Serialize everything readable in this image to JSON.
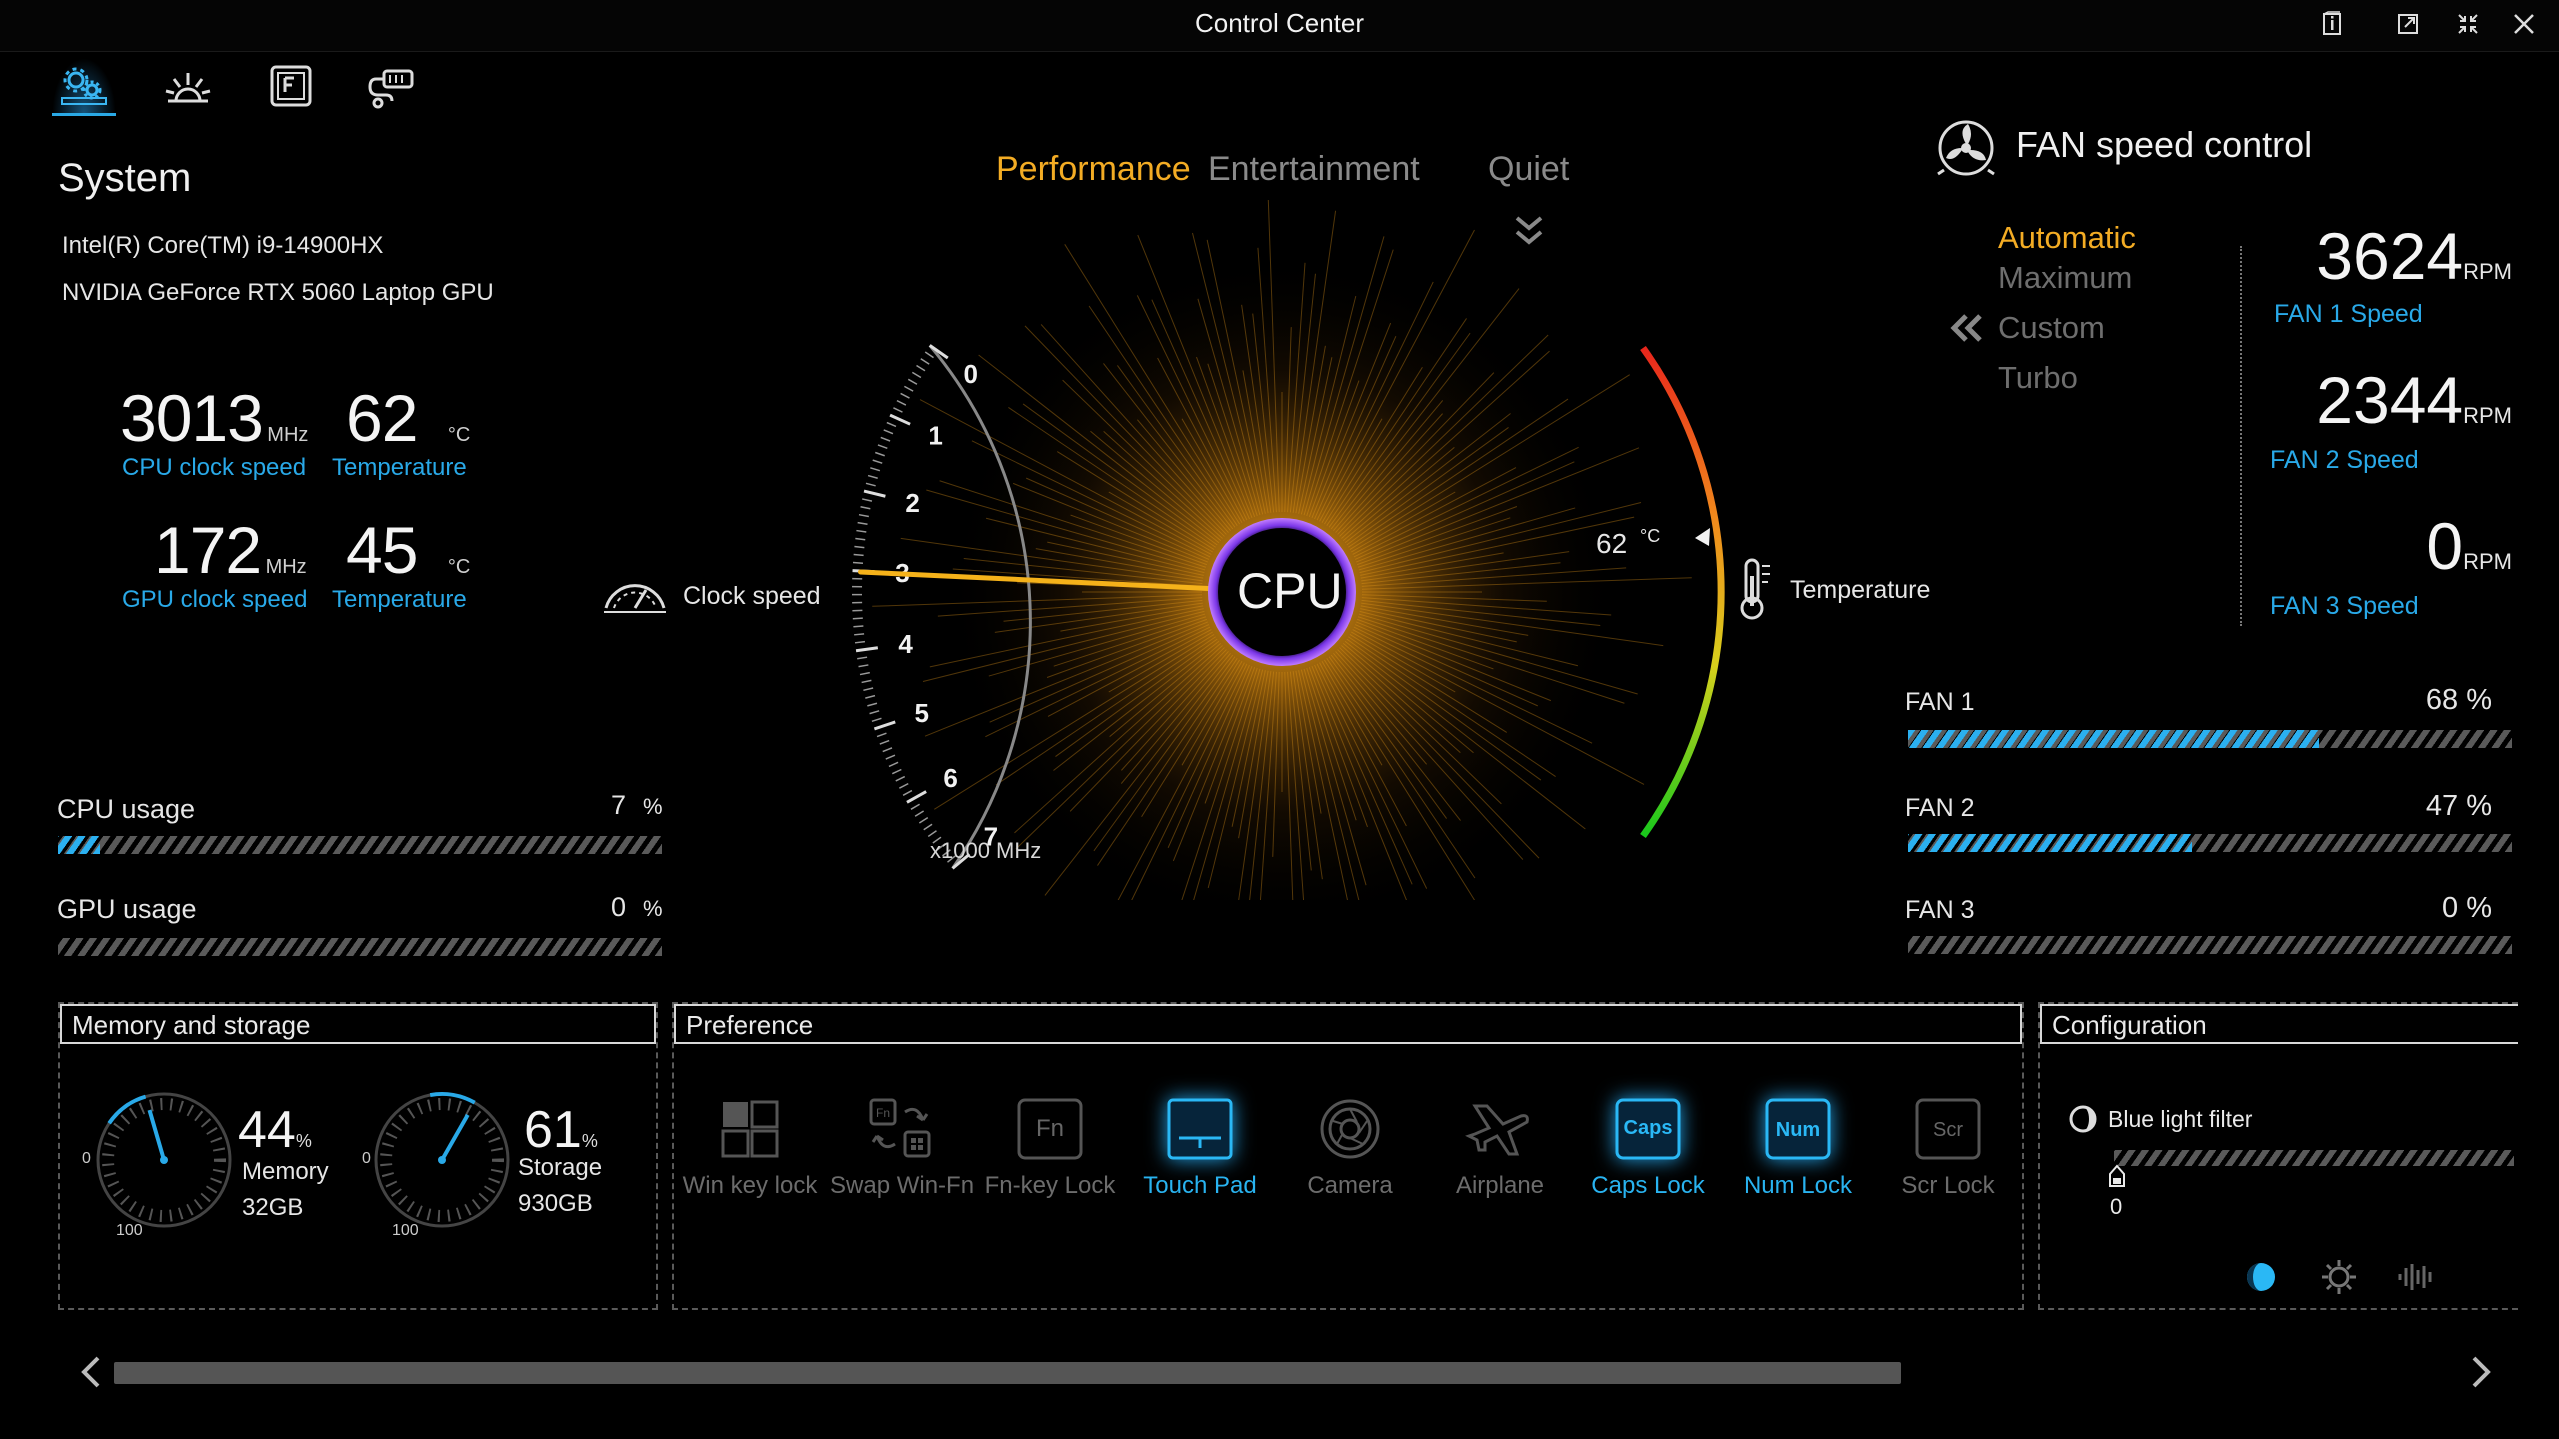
{
  "window": {
    "title": "Control Center"
  },
  "top_tabs": [
    {
      "name": "system-settings",
      "active": true
    },
    {
      "name": "display-brightness",
      "active": false
    },
    {
      "name": "function-keys",
      "active": false
    },
    {
      "name": "hardware-info",
      "active": false
    }
  ],
  "system": {
    "title": "System",
    "cpu_model": "Intel(R) Core(TM) i9-14900HX",
    "gpu_model": "NVIDIA GeForce RTX 5060 Laptop GPU",
    "cpu_clock": {
      "value": "3013",
      "unit": "MHz",
      "caption": "CPU clock speed"
    },
    "cpu_temp": {
      "value": "62",
      "unit": "°C",
      "caption": "Temperature"
    },
    "gpu_clock": {
      "value": "172",
      "unit": "MHz",
      "caption": "GPU clock speed"
    },
    "gpu_temp": {
      "value": "45",
      "unit": "°C",
      "caption": "Temperature"
    },
    "cpu_usage": {
      "label": "CPU usage",
      "value": "7",
      "unit": "%",
      "percent": 7
    },
    "gpu_usage": {
      "label": "GPU usage",
      "value": "0",
      "unit": "%",
      "percent": 0
    }
  },
  "modes": {
    "performance": "Performance",
    "entertainment": "Entertainment",
    "quiet": "Quiet",
    "selected": "Performance"
  },
  "gauge": {
    "center_label": "CPU",
    "clock_label": "Clock speed",
    "temp_label": "Temperature",
    "scale_unit": "x1000 MHz",
    "ticks": [
      "0",
      "1",
      "2",
      "3",
      "4",
      "5",
      "6",
      "7"
    ],
    "clock_value_ghz": 3.013,
    "temp_value": "62",
    "temp_unit": "°C"
  },
  "fan": {
    "title": "FAN speed control",
    "modes": [
      "Automatic",
      "Maximum",
      "Custom",
      "Turbo"
    ],
    "selected_mode": "Automatic",
    "speeds": [
      {
        "value": "3624",
        "unit": "RPM",
        "caption": "FAN 1 Speed"
      },
      {
        "value": "2344",
        "unit": "RPM",
        "caption": "FAN 2 Speed"
      },
      {
        "value": "0",
        "unit": "RPM",
        "caption": "FAN 3 Speed"
      }
    ],
    "bars": [
      {
        "label": "FAN 1",
        "value": "68 %",
        "percent": 68
      },
      {
        "label": "FAN 2",
        "value": "47 %",
        "percent": 47
      },
      {
        "label": "FAN 3",
        "value": "0 %",
        "percent": 0
      }
    ]
  },
  "memory_storage": {
    "title": "Memory and storage",
    "memory": {
      "percent": "44",
      "pct_unit": "%",
      "label": "Memory",
      "size": "32GB",
      "min": "0",
      "max": "100"
    },
    "storage": {
      "percent": "61",
      "pct_unit": "%",
      "label": "Storage",
      "size": "930GB",
      "min": "0",
      "max": "100"
    }
  },
  "preference": {
    "title": "Preference",
    "items": [
      {
        "label": "Win key lock",
        "on": false
      },
      {
        "label": "Swap Win-Fn",
        "on": false
      },
      {
        "label": "Fn-key Lock",
        "on": false
      },
      {
        "label": "Touch Pad",
        "on": true
      },
      {
        "label": "Camera",
        "on": false
      },
      {
        "label": "Airplane",
        "on": false
      },
      {
        "label": "Caps Lock",
        "on": true
      },
      {
        "label": "Num Lock",
        "on": true
      },
      {
        "label": "Scr Lock",
        "on": false
      }
    ],
    "key_caps": {
      "fn": "Fn",
      "caps": "Caps",
      "num": "Num",
      "scr": "Scr"
    }
  },
  "configuration": {
    "title": "Configuration",
    "blue_light_label": "Blue light filter",
    "blue_light_value": "0",
    "icons": [
      "eye-care-icon",
      "brightness-icon",
      "audio-icon"
    ]
  },
  "colors": {
    "accent_blue": "#29a9e8",
    "accent_orange": "#f3ac24",
    "purple_ring": "#8a3cf0"
  }
}
